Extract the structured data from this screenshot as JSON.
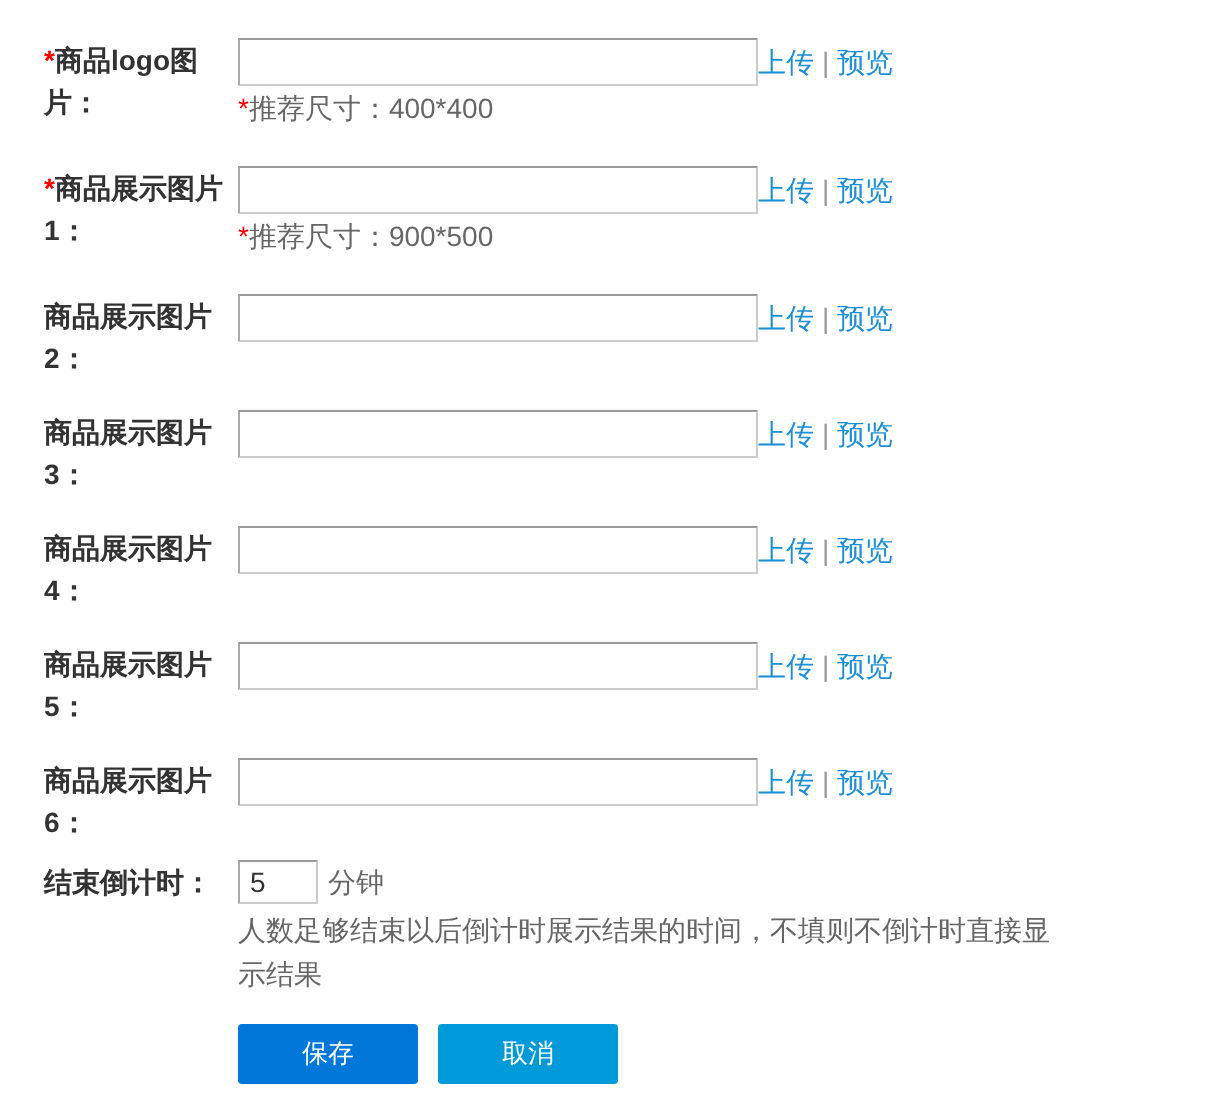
{
  "image_fields": [
    {
      "mark": "*",
      "label": "商品logo图片：",
      "hint_mark": "*",
      "hint": "推荐尺寸：400*400",
      "upload": "上传",
      "separator": "|",
      "preview": "预览"
    },
    {
      "mark": "*",
      "label": "商品展示图片1：",
      "hint_mark": "*",
      "hint": "推荐尺寸：900*500",
      "upload": "上传",
      "separator": "|",
      "preview": "预览"
    },
    {
      "label": "商品展示图片2：",
      "upload": "上传",
      "separator": "|",
      "preview": "预览"
    },
    {
      "label": "商品展示图片3：",
      "upload": "上传",
      "separator": "|",
      "preview": "预览"
    },
    {
      "label": "商品展示图片4：",
      "upload": "上传",
      "separator": "|",
      "preview": "预览"
    },
    {
      "label": "商品展示图片5：",
      "upload": "上传",
      "separator": "|",
      "preview": "预览"
    },
    {
      "label": "商品展示图片6：",
      "upload": "上传",
      "separator": "|",
      "preview": "预览"
    }
  ],
  "countdown": {
    "label": "结束倒计时：",
    "value": "5",
    "unit": "分钟",
    "description": "人数足够结束以后倒计时展示结果的时间，不填则不倒计时直接显示结果"
  },
  "buttons": [
    {
      "kind": "primary",
      "label": "保存"
    },
    {
      "kind": "secondary",
      "label": "取消"
    }
  ]
}
